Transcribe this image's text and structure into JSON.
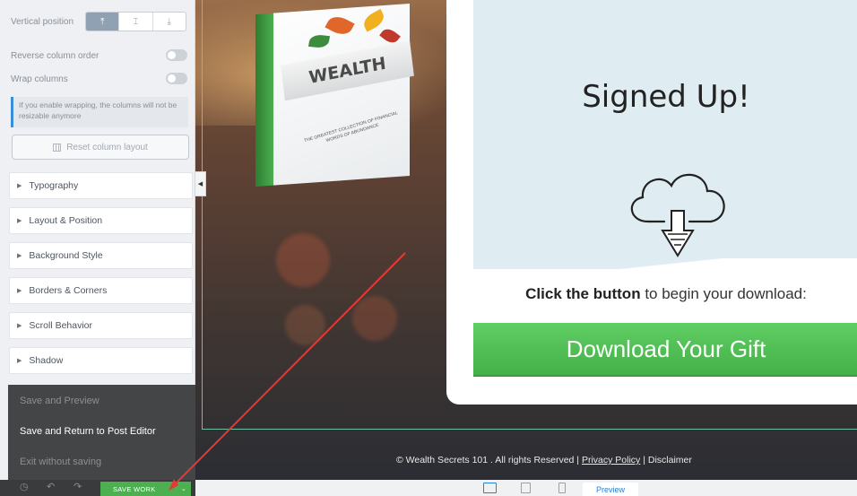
{
  "sidebar": {
    "vertical_position_label": "Vertical position",
    "vpos_options": [
      "⤒",
      "⌶",
      "⤓"
    ],
    "reverse_column_label": "Reverse column order",
    "wrap_columns_label": "Wrap columns",
    "wrap_notice": "If you enable wrapping, the columns will not be resizable anymore",
    "reset_layout_label": "Reset column layout",
    "sections": [
      "Typography",
      "Layout & Position",
      "Background Style",
      "Borders & Corners",
      "Scroll Behavior",
      "Shadow"
    ],
    "collapse_glyph": "◀"
  },
  "save_menu": {
    "save_preview": "Save and Preview",
    "save_return": "Save and Return to Post Editor",
    "exit": "Exit without saving"
  },
  "bottom_bar": {
    "history_icon": "◷",
    "undo_icon": "↶",
    "redo_icon": "↷",
    "save_work": "SAVE WORK",
    "dropdown": "⌄"
  },
  "canvas": {
    "book_title": "WEALTH",
    "book_subtitle": "THE GREATEST COLLECTION OF FINANCIAL WORDS OF ABUNDANCE",
    "heading": "Signed Up!",
    "click_bold": "Click the button",
    "click_rest": " to begin your download:",
    "download_button": "Download Your Gift",
    "footer_prefix": "© Wealth Secrets 101 . All rights Reserved | ",
    "footer_privacy": "Privacy Policy",
    "footer_sep": " | ",
    "footer_disclaimer": "Disclaimer"
  },
  "device_bar": {
    "preview_label": "Preview"
  },
  "colors": {
    "accent_green": "#4caf50",
    "annotation_arrow": "#e53935"
  }
}
